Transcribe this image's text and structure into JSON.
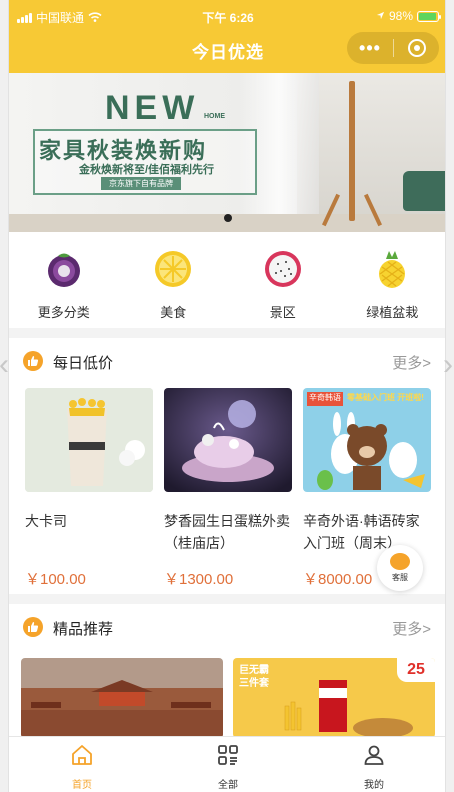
{
  "status_bar": {
    "carrier": "中国联通",
    "time": "下午 6:26",
    "battery": "98%"
  },
  "header": {
    "title": "今日优选",
    "more_icon": "ellipsis-icon",
    "close_icon": "target-icon"
  },
  "banner": {
    "title_en": "NEW",
    "title_en_small": "HOME",
    "headline": "家具秋装焕新购",
    "subline": "金秋焕新将至/佳佰福利先行",
    "tag": "京东旗下自有品牌",
    "slide_count": 1,
    "active_slide": 1
  },
  "categories": [
    {
      "label": "更多分类",
      "icon": "mangosteen-icon"
    },
    {
      "label": "美食",
      "icon": "lemon-icon"
    },
    {
      "label": "景区",
      "icon": "dragonfruit-icon"
    },
    {
      "label": "绿植盆栽",
      "icon": "pineapple-icon"
    }
  ],
  "daily_deals": {
    "title": "每日低价",
    "more": "更多>",
    "items": [
      {
        "name": "大卡司",
        "price": "￥100.00"
      },
      {
        "name": "梦香园生日蛋糕外卖（桂庙店）",
        "price": "￥1300.00"
      },
      {
        "name": "辛奇外语·韩语砖家入门班（周末）",
        "price": "￥8000.00",
        "img_text_1": "辛奇韩语",
        "img_text_2": "零基础入门班 开班啦!"
      }
    ]
  },
  "featured": {
    "title": "精品推荐",
    "more": "更多>",
    "card2_text": "巨无霸三件套",
    "card2_price": "25"
  },
  "customer_service": {
    "label": "客服"
  },
  "tabbar": [
    {
      "label": "首页",
      "icon": "home-icon",
      "active": true
    },
    {
      "label": "全部",
      "icon": "grid-icon",
      "active": false
    },
    {
      "label": "我的",
      "icon": "user-icon",
      "active": false
    }
  ],
  "colors": {
    "accent": "#f7c935",
    "orange": "#f5a32a",
    "price": "#e0703a"
  }
}
